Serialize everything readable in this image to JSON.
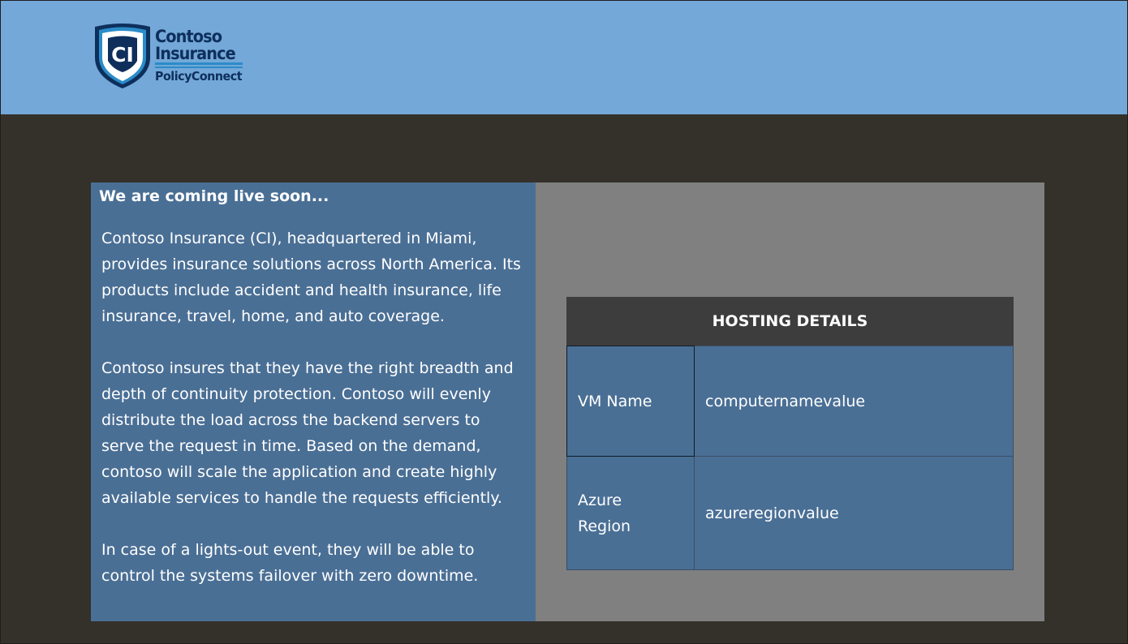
{
  "header": {
    "logo": {
      "monogram": "CI",
      "line1": "Contoso",
      "line2": "Insurance",
      "line3": "PolicyConnect"
    }
  },
  "intro": {
    "heading": "We are coming live soon...",
    "paragraphs": [
      "Contoso Insurance (CI), headquartered in Miami, provides insurance solutions across North America. Its products include accident and health insurance, life insurance, travel, home, and auto coverage.",
      "Contoso insures that they have the right breadth and depth of continuity protection. Contoso will evenly distribute the load across the backend servers to serve the request in time. Based on the demand, contoso will scale the application and create highly available services to handle the requests efficiently.",
      "In case of a lights-out event, they will be able to control the systems failover with zero downtime."
    ]
  },
  "hosting": {
    "title": "HOSTING DETAILS",
    "rows": [
      {
        "label": "VM Name",
        "value": "computernamevalue"
      },
      {
        "label": "Azure Region",
        "value": "azureregionvalue"
      }
    ]
  },
  "colors": {
    "header_bg": "#73a8d8",
    "page_bg": "#34312a",
    "panel_bg": "#808080",
    "card_bg": "#4a6f95",
    "table_head_bg": "#3d3d3d",
    "logo_navy": "#0e2f5c",
    "logo_accent": "#2a8cc8"
  }
}
